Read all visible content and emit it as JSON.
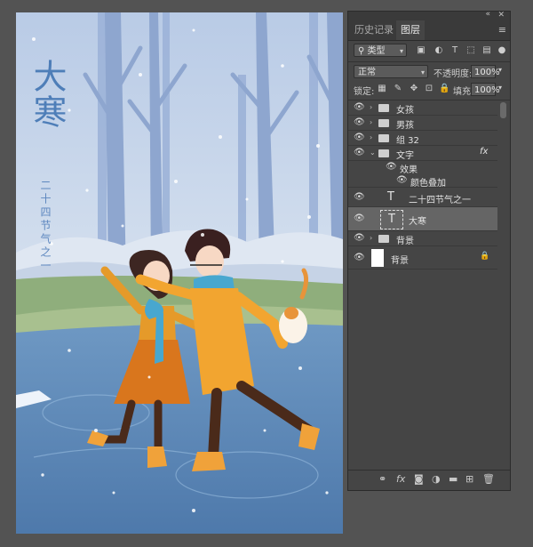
{
  "canvas": {
    "title_text": "大寒",
    "subtitle_text": "二十四节气之一"
  },
  "panel": {
    "collapse_icon": "«",
    "close_icon": "✕",
    "tabs": [
      {
        "label": "历史记录",
        "active": false
      },
      {
        "label": "图层",
        "active": true
      }
    ],
    "menu_icon": "≡",
    "filter": {
      "label": "类型",
      "search_icon": "⚲"
    },
    "blend_mode": "正常",
    "opacity_label": "不透明度:",
    "opacity_value": "100%",
    "lock_label": "锁定:",
    "fill_label": "填充:",
    "fill_value": "100%",
    "layers": [
      {
        "name": "女孩",
        "kind": "group",
        "collapsed": true
      },
      {
        "name": "男孩",
        "kind": "group",
        "collapsed": true
      },
      {
        "name": "组 32",
        "kind": "group",
        "collapsed": true
      },
      {
        "name": "文字",
        "kind": "group",
        "collapsed": false,
        "fx": "fx"
      },
      {
        "name": "效果",
        "kind": "effects-header"
      },
      {
        "name": "颜色叠加",
        "kind": "effect"
      },
      {
        "name": "二十四节气之一",
        "kind": "text"
      },
      {
        "name": "大寒",
        "kind": "text",
        "selected": true
      },
      {
        "name": "背景",
        "kind": "group",
        "collapsed": true
      },
      {
        "name": "背景",
        "kind": "pixel",
        "locked": true
      }
    ],
    "bottom_icons": [
      "link-icon",
      "fx-icon",
      "mask-icon",
      "adjustment-icon",
      "folder-icon",
      "new-layer-icon",
      "trash-icon"
    ]
  }
}
